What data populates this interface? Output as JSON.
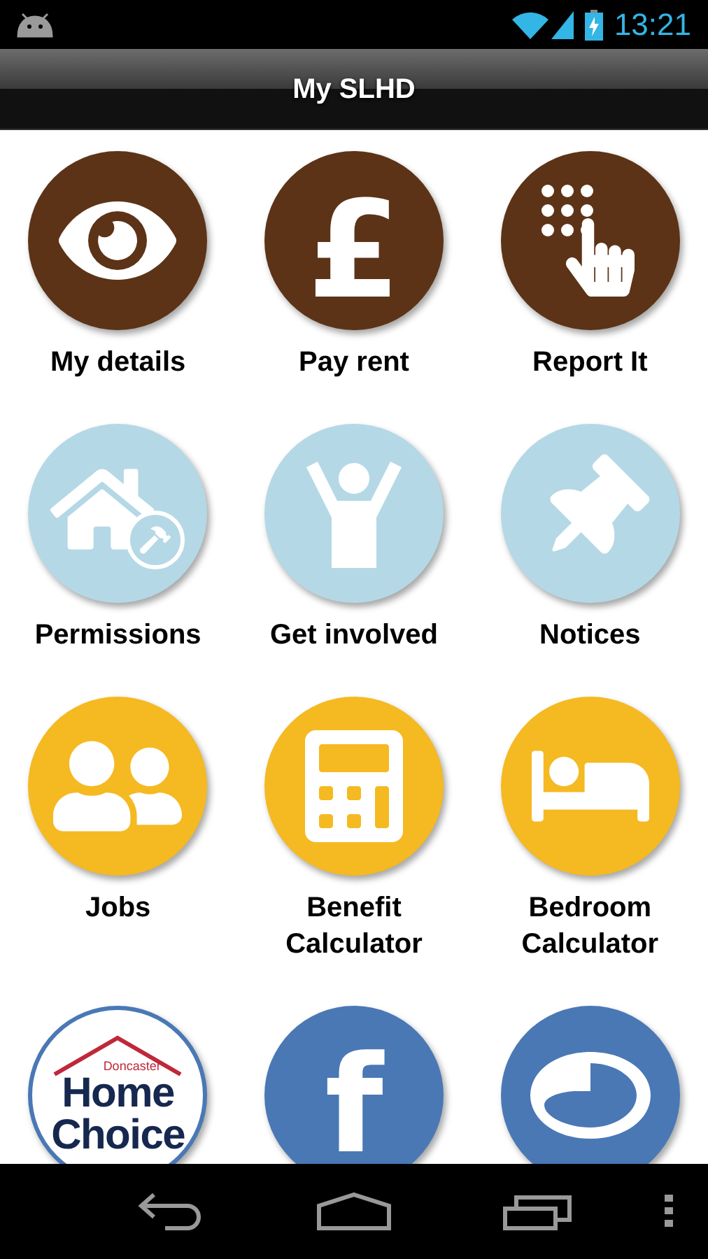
{
  "status_bar": {
    "time": "13:21"
  },
  "action_bar": {
    "title": "My SLHD"
  },
  "tiles": [
    {
      "kind": "icon",
      "label": "My details",
      "color": "#5c3317"
    },
    {
      "kind": "glyph",
      "glyph": "£",
      "label": "Pay rent",
      "color": "#5c3317"
    },
    {
      "kind": "icon",
      "label": "Report It",
      "color": "#5c3317"
    },
    {
      "kind": "icon",
      "label": "Permissions",
      "color": "#b5d8e6"
    },
    {
      "kind": "icon",
      "label": "Get involved",
      "color": "#b5d8e6"
    },
    {
      "kind": "icon",
      "label": "Notices",
      "color": "#b5d8e6"
    },
    {
      "kind": "icon",
      "label": "Jobs",
      "color": "#f5b921"
    },
    {
      "kind": "icon",
      "label": "Benefit Calculator",
      "color": "#f5b921"
    },
    {
      "kind": "icon",
      "label": "Bedroom Calculator",
      "color": "#f5b921"
    },
    {
      "kind": "logo",
      "small": "Doncaster",
      "lines": [
        "Home",
        "Choice"
      ],
      "color": "#ffffff"
    },
    {
      "kind": "glyph",
      "glyph": "f",
      "color": "#4a78b5"
    },
    {
      "kind": "icon",
      "color": "#4a78b5"
    }
  ]
}
